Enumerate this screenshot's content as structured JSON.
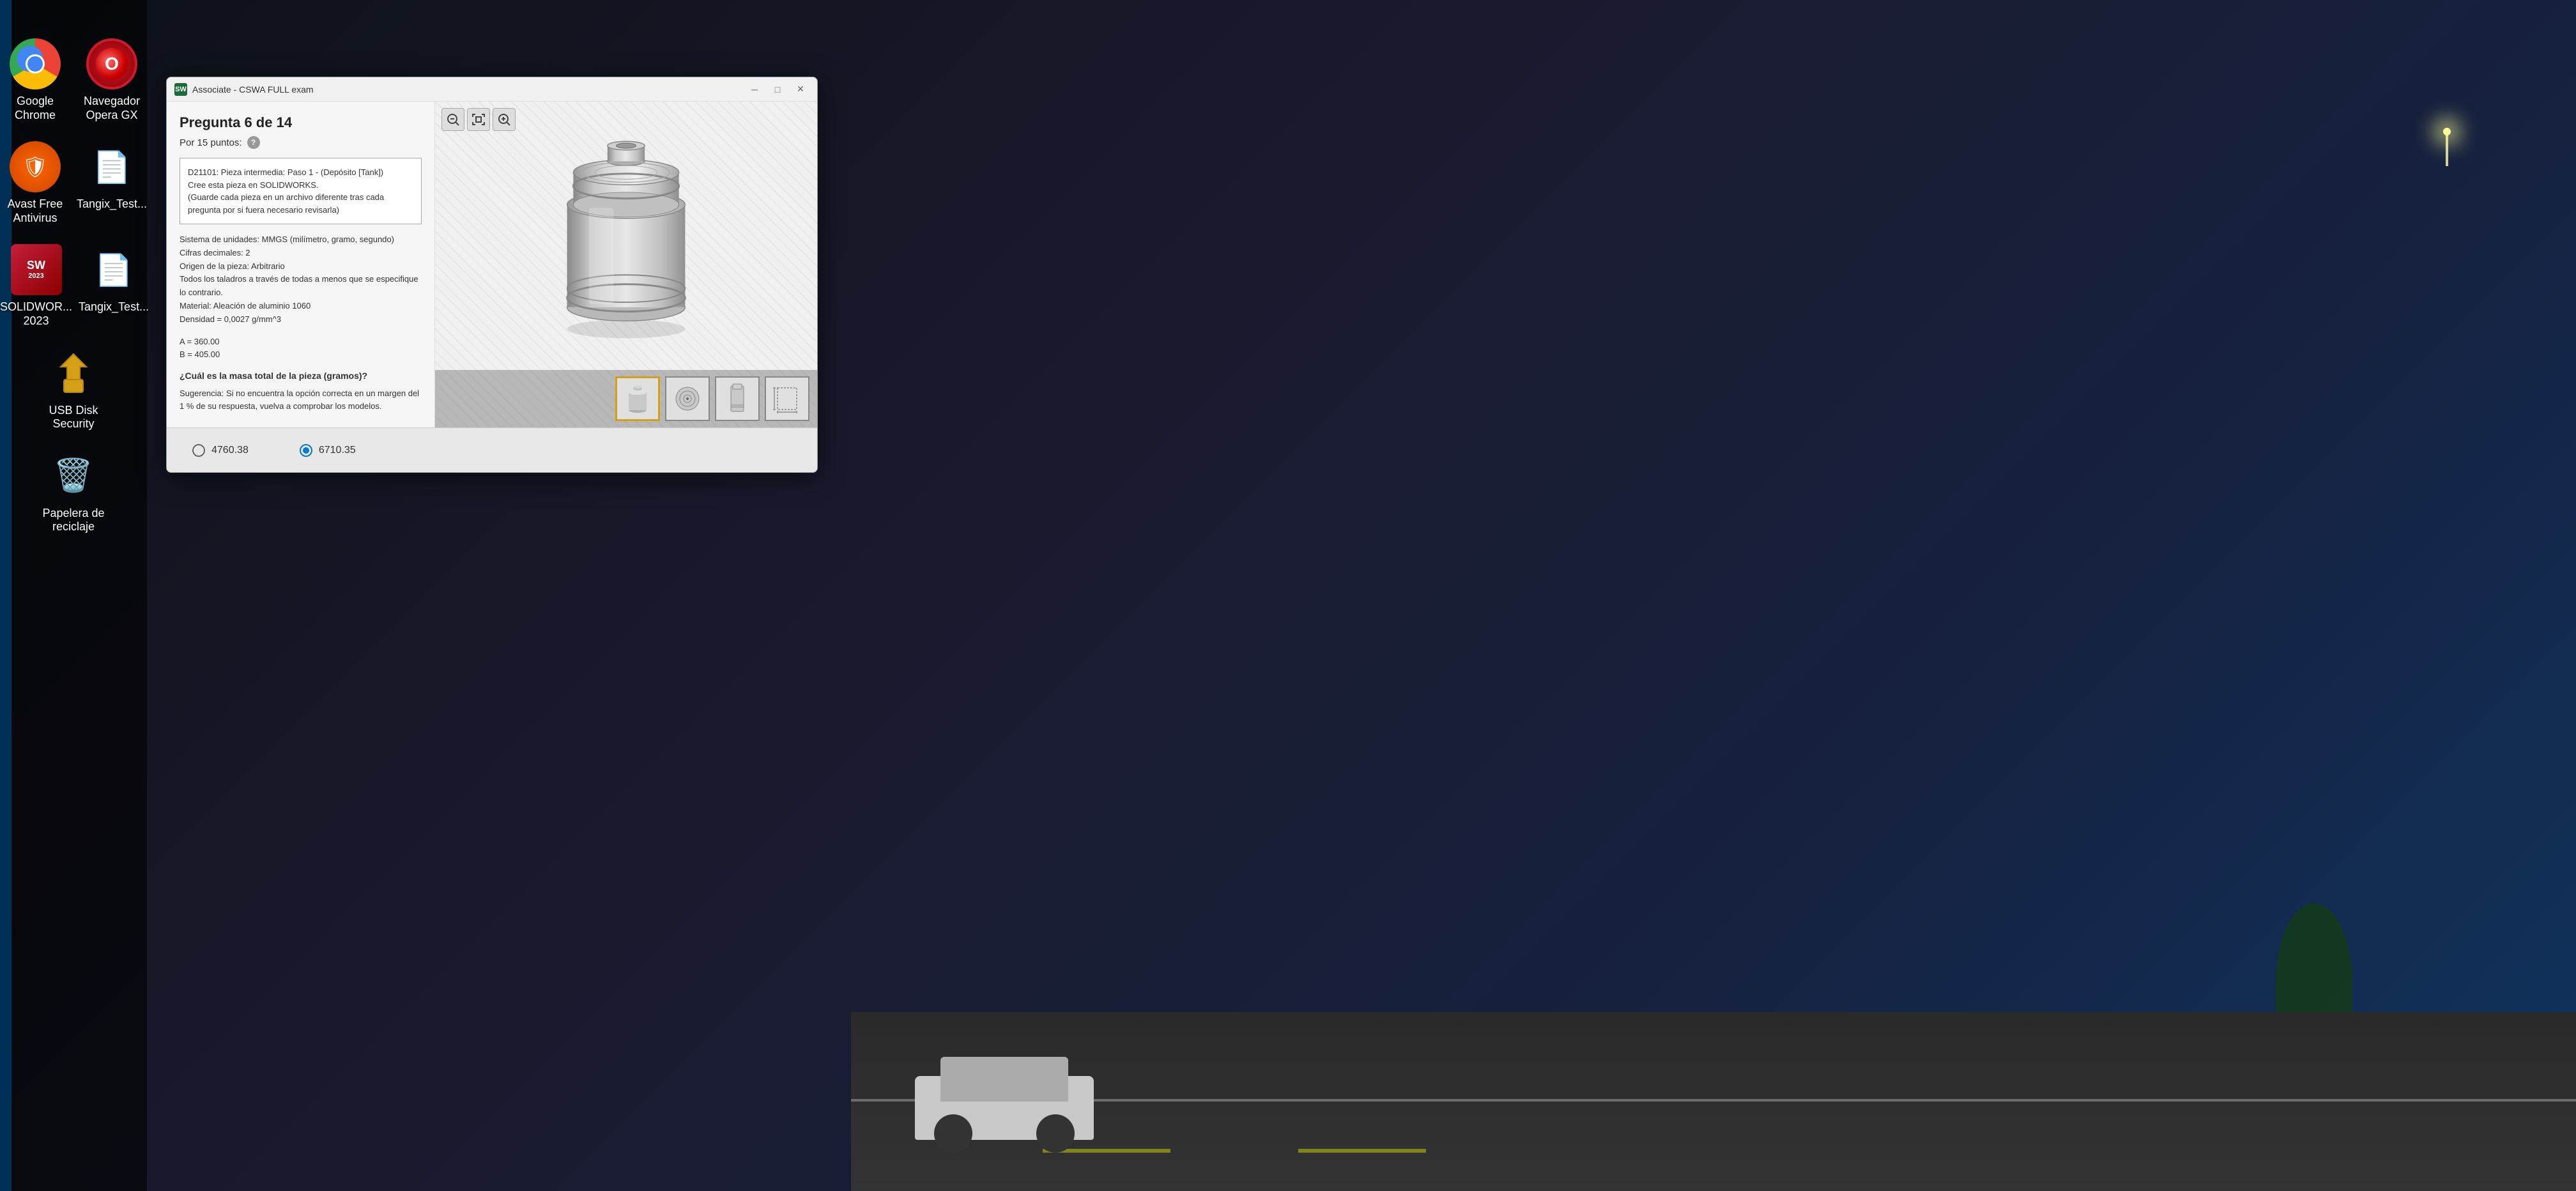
{
  "desktop": {
    "background": "city-night"
  },
  "taskbar": {
    "icons": [
      {
        "id": "google-chrome",
        "label": "Google Chrome",
        "type": "chrome"
      },
      {
        "id": "opera-gx",
        "label": "Navegador Opera GX",
        "type": "opera"
      },
      {
        "id": "avast",
        "label": "Avast Free Antivirus",
        "type": "avast"
      },
      {
        "id": "tangix1",
        "label": "Tangix_Test...",
        "type": "file"
      },
      {
        "id": "solidworks",
        "label": "SOLIDWOR... 2023",
        "type": "sw"
      },
      {
        "id": "tangix2",
        "label": "Tangix_Test...",
        "type": "file"
      },
      {
        "id": "usb-disk",
        "label": "USB Disk Security",
        "type": "usb"
      },
      {
        "id": "recycle",
        "label": "Papelera de reciclaje",
        "type": "recycle"
      }
    ]
  },
  "window": {
    "title": "Associate - CSWA FULL exam",
    "question_title": "Pregunta 6 de 14",
    "points_label": "Por 15 puntos:",
    "description": {
      "line1": "D21101:  Pieza intermedia: Paso 1 - (Depósito [Tank])",
      "line2": "Cree esta pieza en SOLIDWORKS.",
      "line3": "(Guarde cada pieza en un archivo diferente tras cada",
      "line4": "pregunta por si fuera necesario revisarla)"
    },
    "specs": {
      "units": "Sistema de unidades: MMGS (milímetro, gramo, segundo)",
      "decimals": "Cifras decimales: 2",
      "origin": "Origen de la pieza: Arbitrario",
      "holes": "Todos los taladros a través de todas a menos que se especifique lo contrario.",
      "material": "Material: Aleación de aluminio 1060",
      "density": "Densidad = 0,0027 g/mm^3"
    },
    "params": {
      "a": "A = 360.00",
      "b": "B = 405.00"
    },
    "question": "¿Cuál es la masa total de la pieza (gramos)?",
    "suggestion": "Sugerencia: Si no encuentra la opción correcta en un margen del 1 % de su respuesta, vuelva a comprobar los modelos.",
    "answers": [
      {
        "id": "ans1",
        "value": "4760.38",
        "selected": false
      },
      {
        "id": "ans2",
        "value": "6710.35",
        "selected": true
      }
    ],
    "viewer": {
      "zoom_out": "🔍",
      "fit": "⊞",
      "zoom_in": "🔍",
      "thumbnails": [
        {
          "id": "view-3d",
          "active": true
        },
        {
          "id": "view-front",
          "active": false
        },
        {
          "id": "view-side",
          "active": false
        },
        {
          "id": "view-top",
          "active": false
        }
      ]
    }
  }
}
